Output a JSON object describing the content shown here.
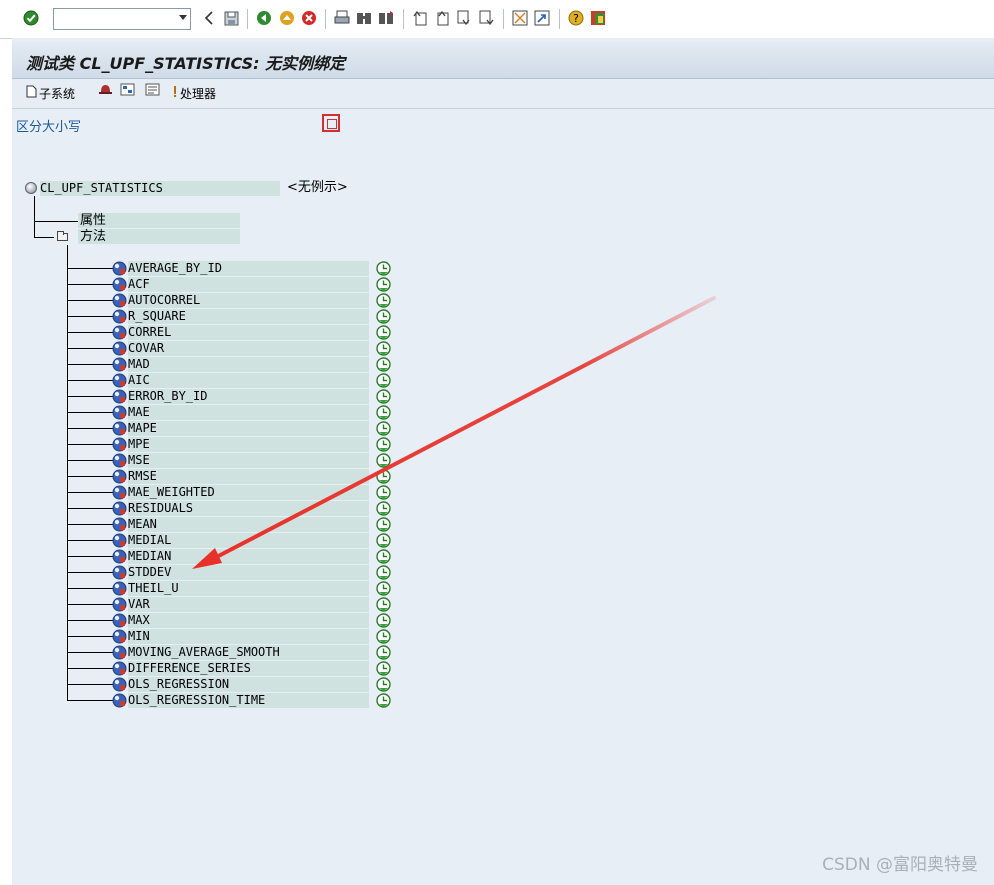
{
  "toolbar": {
    "command_field": {
      "value": "",
      "placeholder": ""
    }
  },
  "header": {
    "title": "测试类 CL_UPF_STATISTICS: 无实例绑定"
  },
  "app_toolbar": {
    "subsystem_label": "子系统",
    "handler_label": "处理器"
  },
  "case_sensitive_label": "区分大小写",
  "tree": {
    "root": {
      "name": "CL_UPF_STATISTICS",
      "instance_label": "<无例示>"
    },
    "nodes": [
      {
        "label": "属性"
      },
      {
        "label": "方法"
      }
    ],
    "methods": [
      "AVERAGE_BY_ID",
      "ACF",
      "AUTOCORREL",
      "R_SQUARE",
      "CORREL",
      "COVAR",
      "MAD",
      "AIC",
      "ERROR_BY_ID",
      "MAE",
      "MAPE",
      "MPE",
      "MSE",
      "RMSE",
      "MAE_WEIGHTED",
      "RESIDUALS",
      "MEAN",
      "MEDIAL",
      "MEDIAN",
      "STDDEV",
      "THEIL_U",
      "VAR",
      "MAX",
      "MIN",
      "MOVING_AVERAGE_SMOOTH",
      "DIFFERENCE_SERIES",
      "OLS_REGRESSION",
      "OLS_REGRESSION_TIME"
    ]
  },
  "colors": {
    "annotation_arrow": "#e8312a",
    "row_highlight": "#cfe2e0",
    "frame_bg": "#e8eef5"
  },
  "watermark": "CSDN @富阳奥特曼"
}
